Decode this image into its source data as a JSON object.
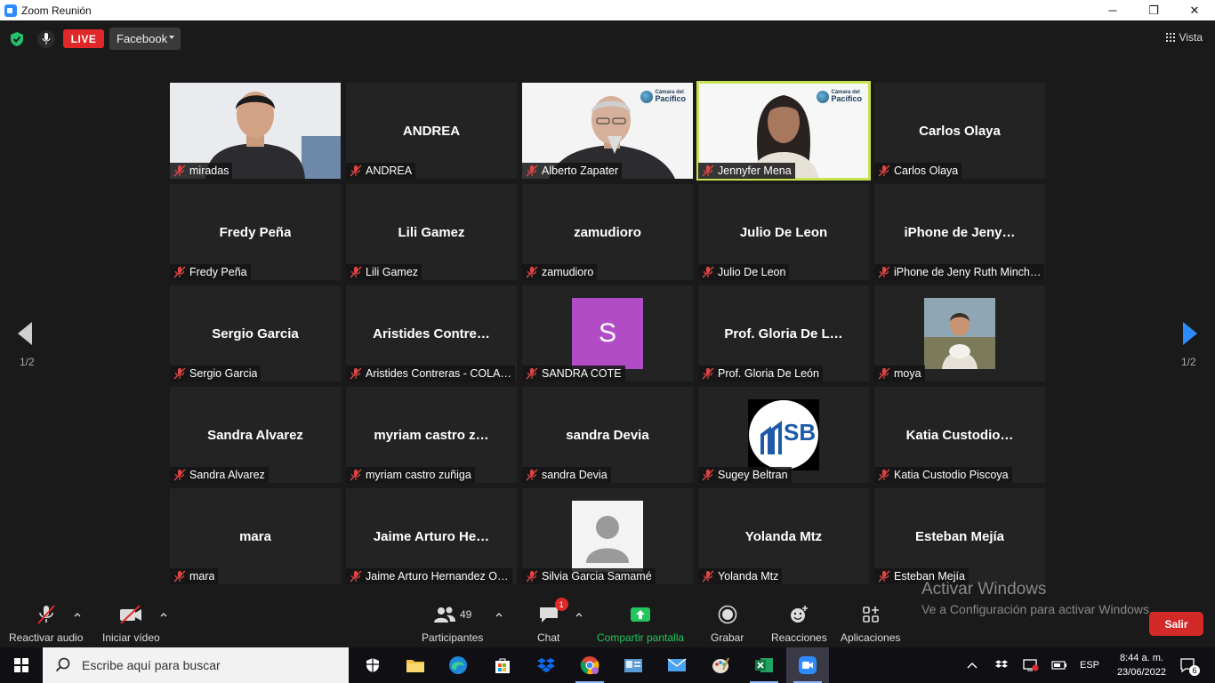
{
  "window": {
    "title": "Zoom Reunión",
    "minimize": "─",
    "maximize": "❐",
    "close": "✕"
  },
  "topbar": {
    "live_label": "LIVE",
    "stream_target": "Facebook",
    "view_label": "Vista"
  },
  "tiles": [
    {
      "bigname": "",
      "label": "miradas",
      "kind": "video-man"
    },
    {
      "bigname": "ANDREA",
      "label": "ANDREA",
      "kind": "name"
    },
    {
      "bigname": "",
      "label": "Alberto Zapater",
      "kind": "video-old"
    },
    {
      "bigname": "",
      "label": "Jennyfer Mena",
      "kind": "video-woman",
      "active": true
    },
    {
      "bigname": "Carlos Olaya",
      "label": "Carlos Olaya",
      "kind": "name"
    },
    {
      "bigname": "Fredy Peña",
      "label": "Fredy Peña",
      "kind": "name"
    },
    {
      "bigname": "Lili Gamez",
      "label": "Lili Gamez",
      "kind": "name"
    },
    {
      "bigname": "zamudioro",
      "label": "zamudioro",
      "kind": "name"
    },
    {
      "bigname": "Julio De Leon",
      "label": "Julio De Leon",
      "kind": "name"
    },
    {
      "bigname": "iPhone  de  Jeny…",
      "label": "iPhone de Jeny Ruth Minch…",
      "kind": "name"
    },
    {
      "bigname": "Sergio Garcia",
      "label": "Sergio Garcia",
      "kind": "name"
    },
    {
      "bigname": "Aristides  Contre…",
      "label": "Aristides Contreras - COLA…",
      "kind": "name"
    },
    {
      "bigname": "",
      "label": "SANDRA COTE",
      "kind": "avatar-s",
      "initial": "S"
    },
    {
      "bigname": "Prof.  Gloria De  L…",
      "label": "Prof. Gloria De León",
      "kind": "name"
    },
    {
      "bigname": "",
      "label": "moya",
      "kind": "avatar-photo"
    },
    {
      "bigname": "Sandra Alvarez",
      "label": "Sandra Alvarez",
      "kind": "name"
    },
    {
      "bigname": "myriam  castro  z…",
      "label": "myriam castro zuñiga",
      "kind": "name"
    },
    {
      "bigname": "sandra Devia",
      "label": "sandra Devia",
      "kind": "name"
    },
    {
      "bigname": "",
      "label": "Sugey Beltran",
      "kind": "avatar-sb",
      "logo_text": "SB"
    },
    {
      "bigname": "Katia  Custodio…",
      "label": "Katia Custodio Piscoya",
      "kind": "name"
    },
    {
      "bigname": "mara",
      "label": "mara",
      "kind": "name"
    },
    {
      "bigname": "Jaime  Arturo  He…",
      "label": "Jaime Arturo Hernandez O…",
      "kind": "name"
    },
    {
      "bigname": "",
      "label": "Silvia Garcia Samamé",
      "kind": "avatar-default"
    },
    {
      "bigname": "Yolanda Mtz",
      "label": "Yolanda Mtz",
      "kind": "name"
    },
    {
      "bigname": "Esteban Mejía",
      "label": "Esteban Mejía",
      "kind": "name"
    }
  ],
  "logo_badge": {
    "line1": "Cámara del",
    "line2": "Pacífico"
  },
  "pagination": {
    "left": "1/2",
    "right": "1/2"
  },
  "watermark": {
    "line1": "Activar Windows",
    "line2": "Ve a Configuración para activar Windows."
  },
  "toolbar": {
    "audio": "Reactivar audio",
    "video": "Iniciar vídeo",
    "participants": "Participantes",
    "participants_count": "49",
    "chat": "Chat",
    "chat_badge": "1",
    "share": "Compartir pantalla",
    "record": "Grabar",
    "reactions": "Reacciones",
    "apps": "Aplicaciones",
    "leave": "Salir"
  },
  "taskbar": {
    "search_placeholder": "Escribe aquí para buscar",
    "lang": "ESP",
    "time": "8:44 a. m.",
    "date": "23/06/2022",
    "notifications": "6"
  },
  "colors": {
    "active_speaker": "#c6e354",
    "live": "#e02828",
    "share": "#22c55e",
    "leave": "#d42929",
    "avatar_s": "#b24cc6"
  }
}
